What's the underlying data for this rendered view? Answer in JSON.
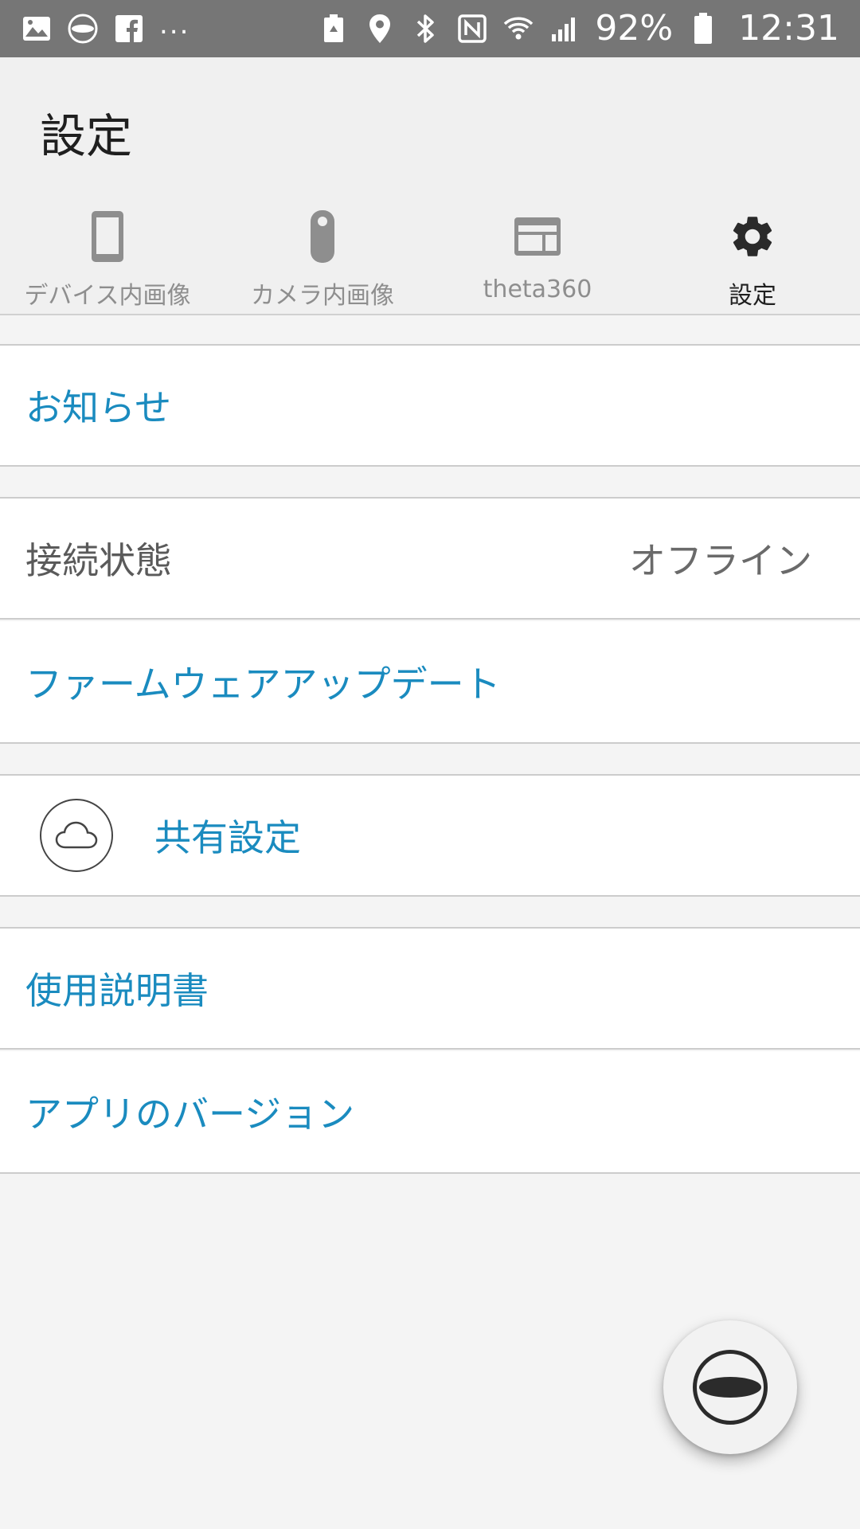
{
  "status_bar": {
    "left_icons": [
      "gallery-icon",
      "theta-icon",
      "facebook-icon"
    ],
    "more": "...",
    "right_icons": [
      "battery-saver-icon",
      "location-icon",
      "bluetooth-icon",
      "nfc-icon",
      "wifi-icon",
      "signal-icon"
    ],
    "battery_percent": "92%",
    "time": "12:31"
  },
  "header": {
    "title": "設定"
  },
  "tabs": [
    {
      "label": "デバイス内画像",
      "icon": "phone-icon",
      "active": false
    },
    {
      "label": "カメラ内画像",
      "icon": "camera-icon",
      "active": false
    },
    {
      "label": "theta360",
      "icon": "web-gallery-icon",
      "active": false
    },
    {
      "label": "設定",
      "icon": "gear-icon",
      "active": true
    }
  ],
  "settings": {
    "notice": "お知らせ",
    "connection_label": "接続状態",
    "connection_value": "オフライン",
    "firmware_update": "ファームウェアアップデート",
    "share_settings": "共有設定",
    "share_icon": "cloud-icon",
    "user_manual": "使用説明書",
    "app_version": "アプリのバージョン"
  },
  "fab": {
    "icon": "theta-camera-icon"
  },
  "colors": {
    "status_bar": "#767676",
    "accent": "#1a8bbf",
    "background": "#f4f4f4"
  }
}
